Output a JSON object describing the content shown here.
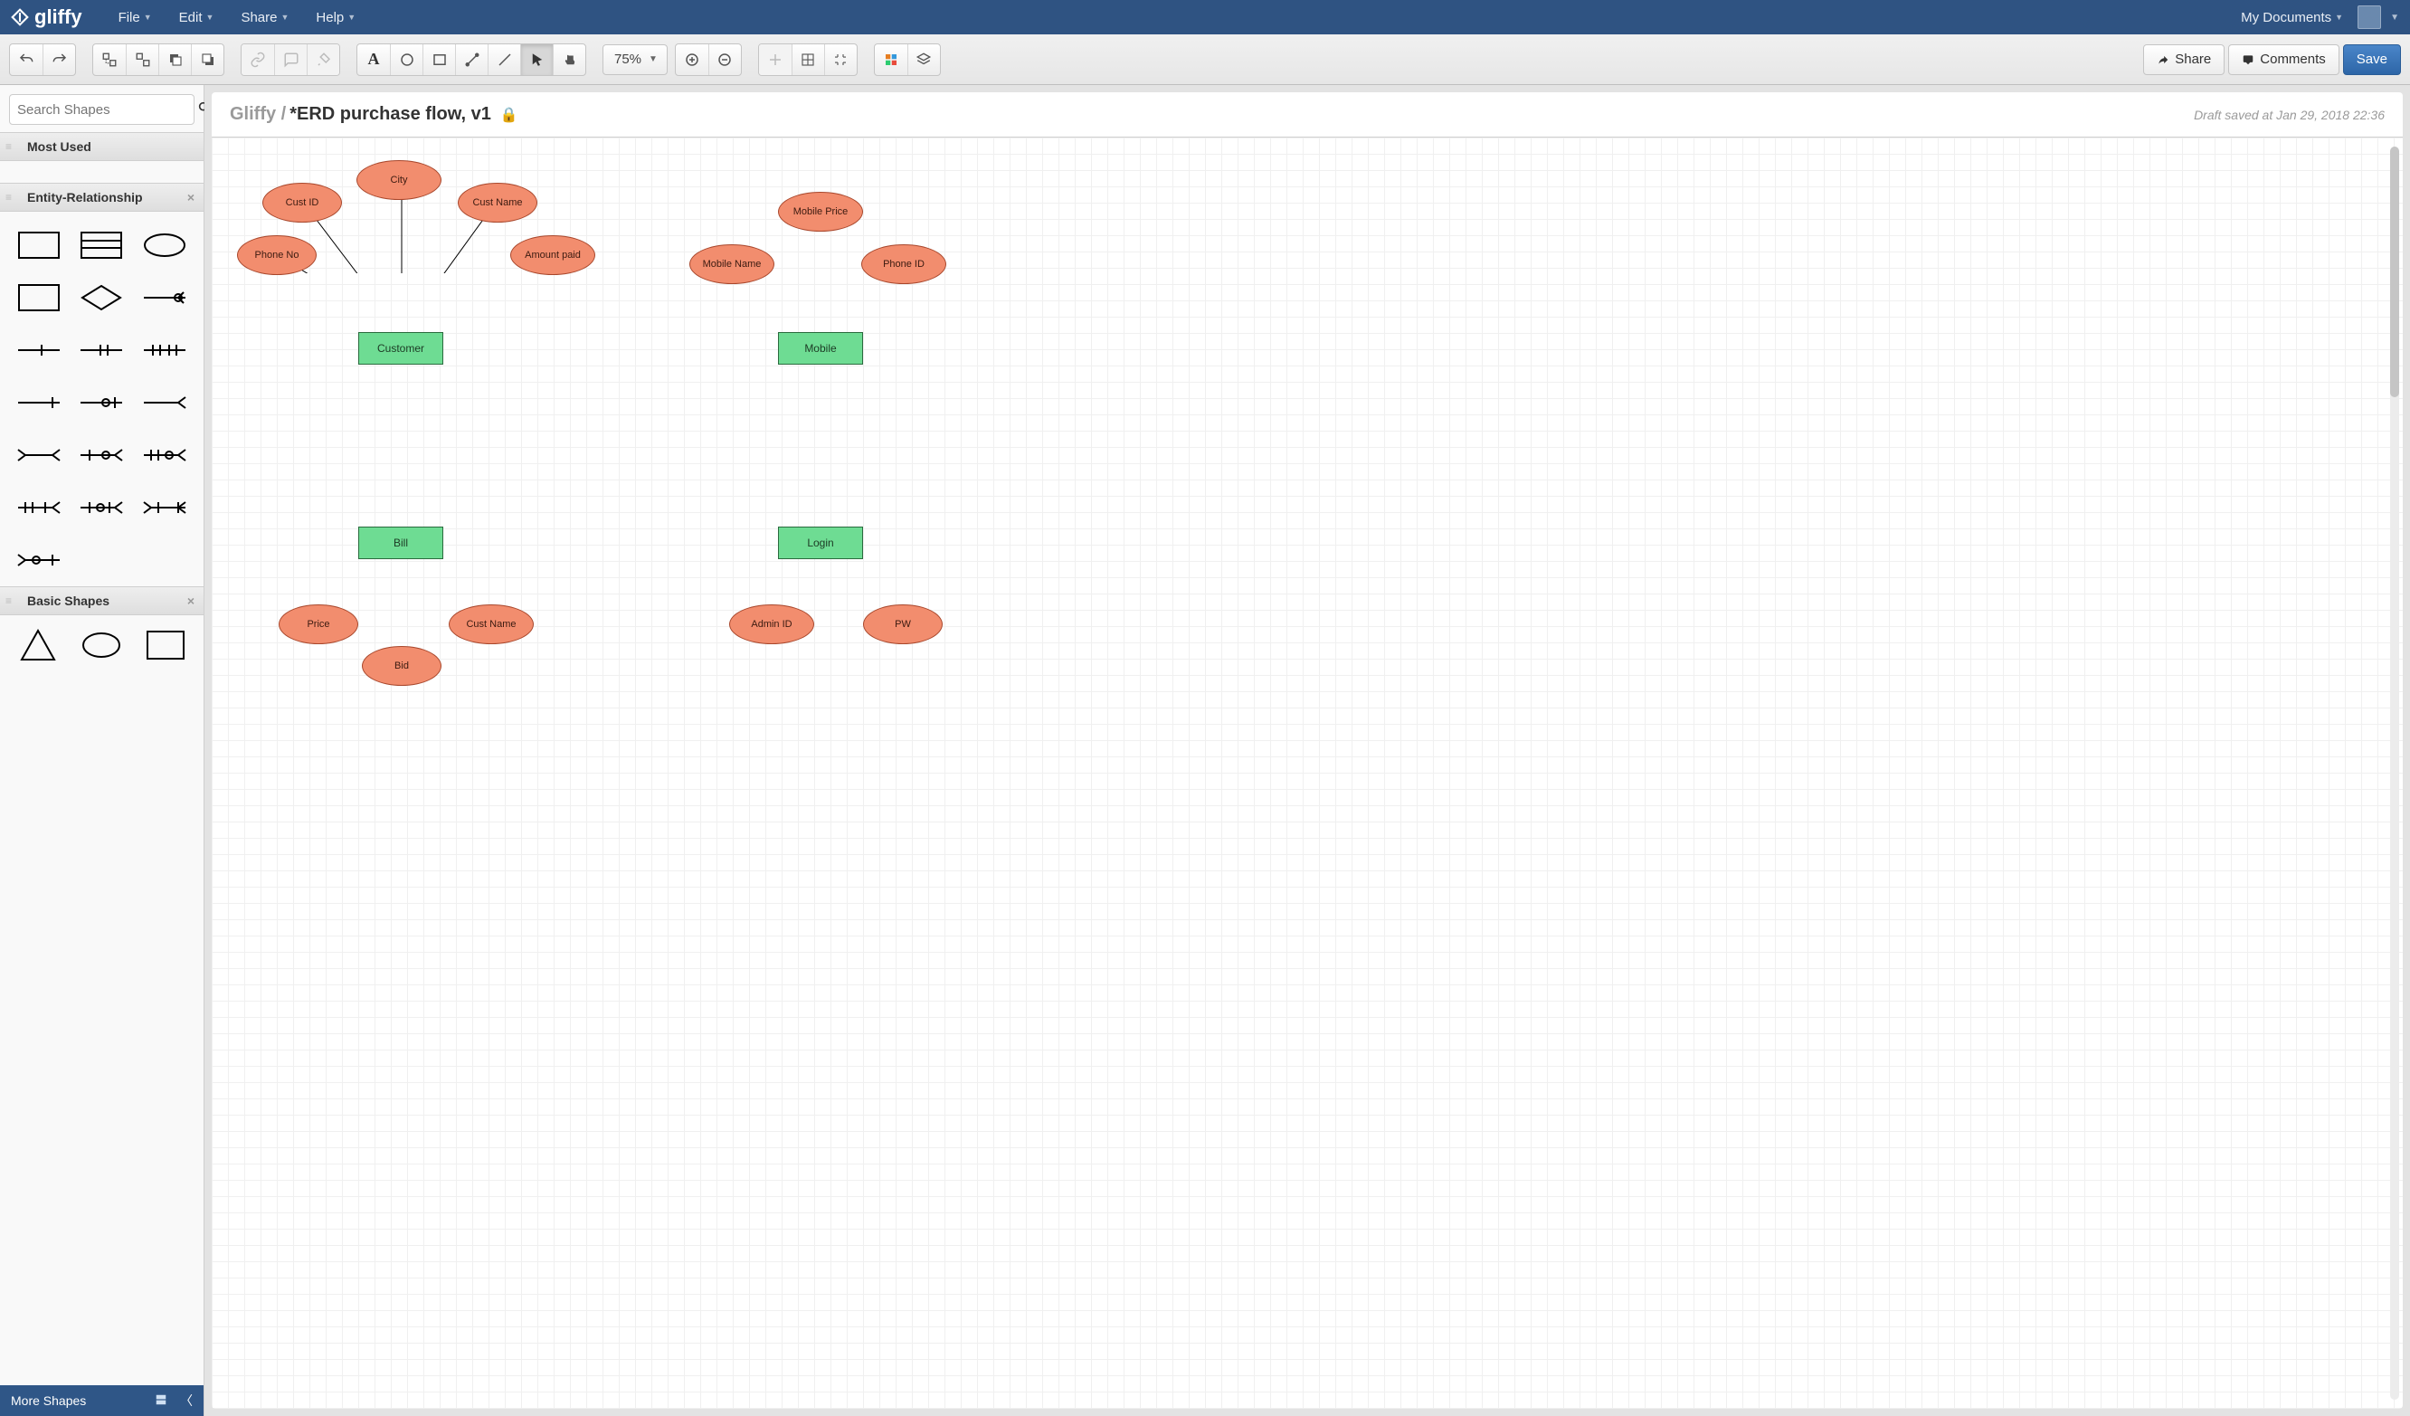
{
  "app": {
    "name": "gliffy"
  },
  "menus": {
    "file": "File",
    "edit": "Edit",
    "share": "Share",
    "help": "Help",
    "my_documents": "My Documents"
  },
  "toolbar": {
    "zoom": "75%",
    "share": "Share",
    "comments": "Comments",
    "save": "Save"
  },
  "sidebar": {
    "search_placeholder": "Search Shapes",
    "categories": {
      "most_used": "Most Used",
      "entity_relationship": "Entity-Relationship",
      "basic_shapes": "Basic Shapes"
    },
    "footer_label": "More Shapes"
  },
  "document": {
    "breadcrumb": "Gliffy /",
    "title": "*ERD purchase flow, v1",
    "saved_text": "Draft saved at Jan 29, 2018 22:36"
  },
  "diagram": {
    "entities": {
      "customer": "Customer",
      "mobile": "Mobile",
      "bill": "Bill",
      "login": "Login"
    },
    "attributes": {
      "phone_no": "Phone No",
      "cust_id": "Cust ID",
      "city": "City",
      "cust_name_1": "Cust Name",
      "amount_paid": "Amount paid",
      "mobile_name": "Mobile Name",
      "mobile_price": "Mobile Price",
      "phone_id": "Phone ID",
      "price": "Price",
      "bid": "Bid",
      "cust_name_2": "Cust Name",
      "admin_id": "Admin ID",
      "pw": "PW"
    }
  }
}
